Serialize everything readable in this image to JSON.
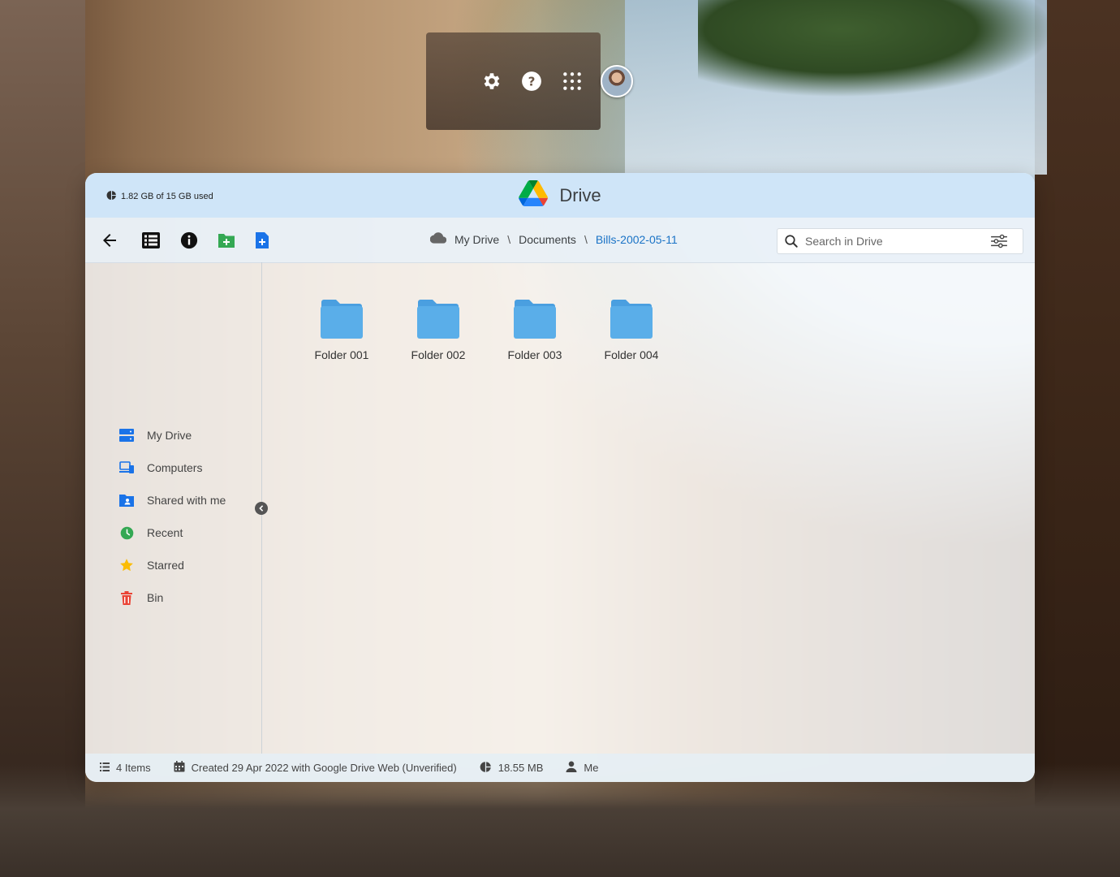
{
  "top_bar": {
    "icons": [
      "settings-icon",
      "help-icon",
      "apps-grid-icon"
    ],
    "avatar": "user-avatar"
  },
  "window": {
    "storage_text": "1.82 GB of 15 GB used",
    "app_title": "Drive",
    "brand_colors": {
      "green": "#1ea362",
      "blue": "#4285f4",
      "yellow": "#ffba00",
      "red": "#ea4335"
    }
  },
  "toolbar": {
    "buttons": [
      "back-arrow-icon",
      "list-view-icon",
      "info-icon",
      "new-folder-icon",
      "new-file-icon"
    ],
    "breadcrumb": {
      "root_icon": "cloud-icon",
      "items": [
        "My Drive",
        "Documents",
        "Bills-2002-05-11"
      ],
      "separator": "\\"
    },
    "search": {
      "placeholder": "Search in Drive",
      "value": ""
    }
  },
  "sidebar": {
    "items": [
      {
        "label": "My Drive",
        "icon": "my-drive-icon",
        "color": "#1a73e8"
      },
      {
        "label": "Computers",
        "icon": "computers-icon",
        "color": "#1a73e8"
      },
      {
        "label": "Shared with me",
        "icon": "shared-icon",
        "color": "#1a73e8"
      },
      {
        "label": "Recent",
        "icon": "clock-icon",
        "color": "#34a853"
      },
      {
        "label": "Starred",
        "icon": "star-icon",
        "color": "#fbbc04"
      },
      {
        "label": "Bin",
        "icon": "trash-icon",
        "color": "#ea4335"
      }
    ]
  },
  "content": {
    "folders": [
      {
        "label": "Folder 001"
      },
      {
        "label": "Folder 002"
      },
      {
        "label": "Folder 003"
      },
      {
        "label": "Folder 004"
      }
    ],
    "folder_color": "#5aaee9"
  },
  "status": {
    "items_count": "4 Items",
    "created": "Created 29 Apr 2022 with Google Drive Web (Unverified)",
    "size": "18.55 MB",
    "owner": "Me"
  }
}
